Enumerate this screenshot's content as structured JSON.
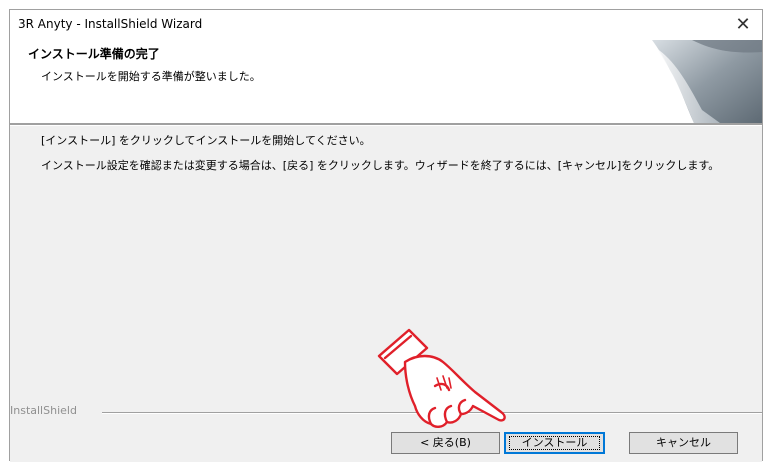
{
  "window": {
    "title": "3R Anyty - InstallShield Wizard",
    "close_glyph": "✕"
  },
  "header": {
    "title": "インストール準備の完了",
    "subtitle": "インストールを開始する準備が整いました。"
  },
  "body": {
    "line1": "[インストール] をクリックしてインストールを開始してください。",
    "line2": "インストール設定を確認または変更する場合は、[戻る] をクリックします。ウィザードを終了するには、[キャンセル]をクリックします。"
  },
  "footer": {
    "brand": "InstallShield",
    "back_label": "< 戻る(B)",
    "install_label": "インストール",
    "cancel_label": "キャンセル"
  },
  "overlay": {
    "pointer_icon": "pointing-hand-icon",
    "accent_color": "#e0202a"
  }
}
